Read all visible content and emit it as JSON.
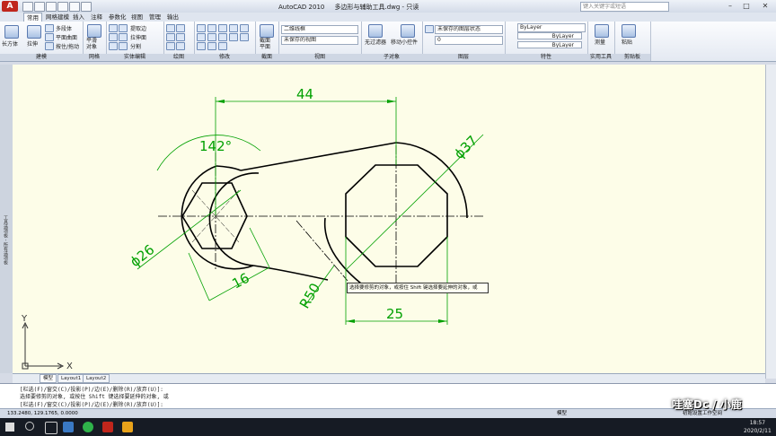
{
  "window": {
    "app_title": "AutoCAD 2010",
    "file_title": "多边形与辅助工具.dwg - 只读",
    "logo_letter": "A",
    "search_placeholder": "键入关键字或短语",
    "minimize": "–",
    "restore": "□",
    "close": "✕"
  },
  "tabs": [
    "常用",
    "网格建模",
    "插入",
    "注释",
    "参数化",
    "视图",
    "管理",
    "输出"
  ],
  "ribbon": {
    "modeling": {
      "box": "长方体",
      "extrude": "拉伸",
      "items": [
        "多段体",
        "平面曲面",
        "按住/拖动"
      ],
      "label": "建模"
    },
    "mesh": {
      "smooth": "平滑\n对象",
      "label": "网格"
    },
    "solid_edit": {
      "items": [
        "提取边",
        "拉伸面",
        "分割"
      ],
      "label": "实体编辑"
    },
    "draw": {
      "label": "绘图"
    },
    "modify": {
      "label": "修改"
    },
    "section": {
      "button": "截面\n平面",
      "label": "截面"
    },
    "view": {
      "visual_style": "二维线框",
      "saved_view": "未保存的视图",
      "label": "视图"
    },
    "subobject": {
      "no_filter": "无过滤器",
      "move_gizmo": "移动小控件",
      "label": "子对象"
    },
    "layers": {
      "layer_state": "未保存的图层状态",
      "current_layer": "0",
      "label": "图层"
    },
    "properties": {
      "color": "ByLayer",
      "linetype": "ByLayer",
      "lineweight": "ByLayer",
      "label": "特性"
    },
    "utilities": {
      "measure": "测量",
      "label": "实用工具"
    },
    "clipboard": {
      "paste": "粘贴",
      "label": "剪贴板"
    }
  },
  "drawing": {
    "dim_44": "44",
    "dim_142": "142°",
    "dim_37": "ϕ37",
    "dim_26": "ϕ26",
    "dim_16": "16",
    "dim_r50": "R50",
    "dim_25": "25",
    "ucs_y": "Y",
    "ucs_x": "X"
  },
  "tooltip": "选择要修剪的对象，或按住 Shift 键选择要延伸的对象，或",
  "layout_tabs": [
    "模型",
    "Layout1",
    "Layout2"
  ],
  "command": {
    "lines": [
      "[栏选(F)/窗交(C)/投影(P)/边(E)/删除(R)/放弃(U)]:",
      "选择要修剪的对象, 或按住 Shift 键选择要延伸的对象, 或",
      "[栏选(F)/窗交(C)/投影(P)/边(E)/删除(R)/放弃(U)]:"
    ]
  },
  "status": {
    "coords": "133.2480, 129.1765, 0.0000",
    "model": "模型",
    "workspace": "初始设置工作空间"
  },
  "palette_label": "工具选项板 - 所有选项板",
  "taskbar": {
    "time": "18:57",
    "date": "2020/2/11"
  },
  "watermark": "哇塞Dc / 小鹿",
  "colors": {
    "canvas": "#fdfde8",
    "geometry": "#000000",
    "dimension": "#00a000",
    "center": "#000000"
  }
}
